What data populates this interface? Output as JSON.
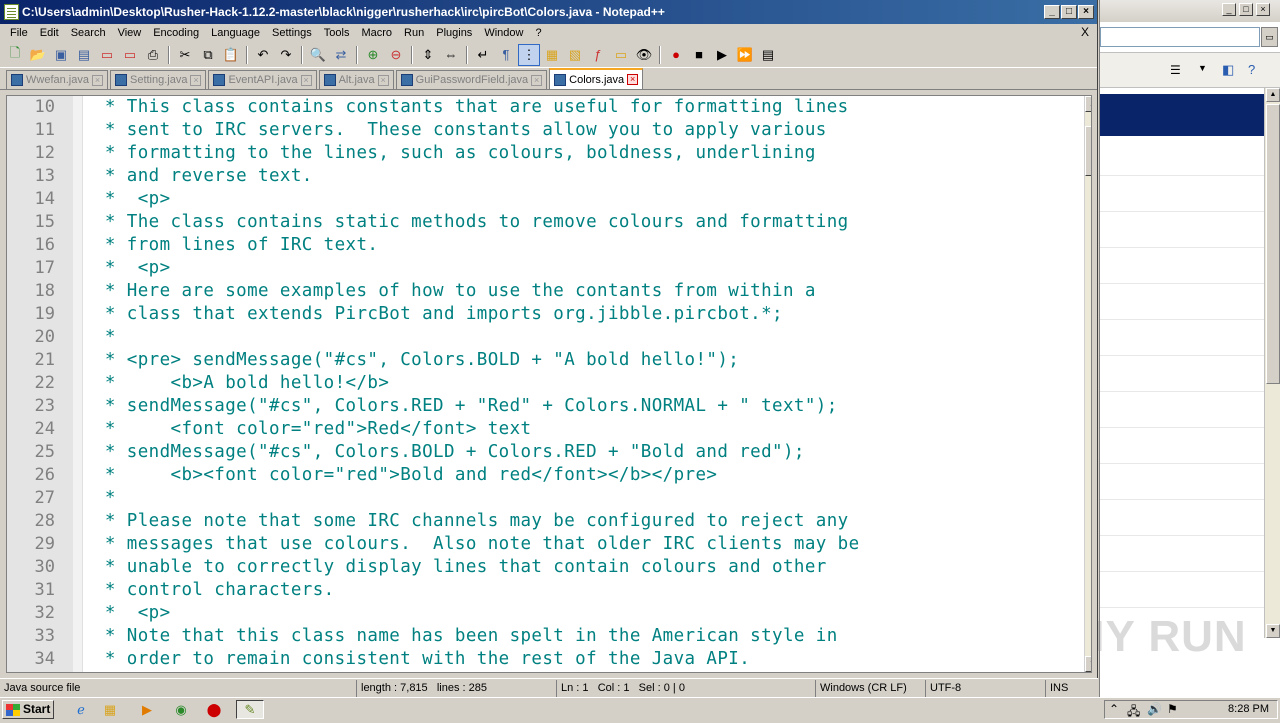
{
  "window": {
    "title": "C:\\Users\\admin\\Desktop\\Rusher-Hack-1.12.2-master\\black\\nigger\\rusherhack\\irc\\pircBot\\Colors.java - Notepad++"
  },
  "menu": [
    "File",
    "Edit",
    "Search",
    "View",
    "Encoding",
    "Language",
    "Settings",
    "Tools",
    "Macro",
    "Run",
    "Plugins",
    "Window",
    "?"
  ],
  "menu_close": "X",
  "tabs": [
    {
      "label": "Wwefan.java"
    },
    {
      "label": "Setting.java"
    },
    {
      "label": "EventAPI.java"
    },
    {
      "label": "Alt.java"
    },
    {
      "label": "GuiPasswordField.java"
    },
    {
      "label": "Colors.java"
    }
  ],
  "lines": [
    {
      "n": "10",
      "t": " * This class contains constants that are useful for formatting lines"
    },
    {
      "n": "11",
      "t": " * sent to IRC servers.  These constants allow you to apply various"
    },
    {
      "n": "12",
      "t": " * formatting to the lines, such as colours, boldness, underlining"
    },
    {
      "n": "13",
      "t": " * and reverse text."
    },
    {
      "n": "14",
      "t": " *  <p>"
    },
    {
      "n": "15",
      "t": " * The class contains static methods to remove colours and formatting"
    },
    {
      "n": "16",
      "t": " * from lines of IRC text."
    },
    {
      "n": "17",
      "t": " *  <p>"
    },
    {
      "n": "18",
      "t": " * Here are some examples of how to use the contants from within a"
    },
    {
      "n": "19",
      "t": " * class that extends PircBot and imports org.jibble.pircbot.*;"
    },
    {
      "n": "20",
      "t": " *"
    },
    {
      "n": "21",
      "t": " * <pre> sendMessage(\"#cs\", Colors.BOLD + \"A bold hello!\");"
    },
    {
      "n": "22",
      "t": " *     <b>A bold hello!</b>"
    },
    {
      "n": "23",
      "t": " * sendMessage(\"#cs\", Colors.RED + \"Red\" + Colors.NORMAL + \" text\");"
    },
    {
      "n": "24",
      "t": " *     <font color=\"red\">Red</font> text"
    },
    {
      "n": "25",
      "t": " * sendMessage(\"#cs\", Colors.BOLD + Colors.RED + \"Bold and red\");"
    },
    {
      "n": "26",
      "t": " *     <b><font color=\"red\">Bold and red</font></b></pre>"
    },
    {
      "n": "27",
      "t": " *"
    },
    {
      "n": "28",
      "t": " * Please note that some IRC channels may be configured to reject any"
    },
    {
      "n": "29",
      "t": " * messages that use colours.  Also note that older IRC clients may be"
    },
    {
      "n": "30",
      "t": " * unable to correctly display lines that contain colours and other"
    },
    {
      "n": "31",
      "t": " * control characters."
    },
    {
      "n": "32",
      "t": " *  <p>"
    },
    {
      "n": "33",
      "t": " * Note that this class name has been spelt in the American style in"
    },
    {
      "n": "34",
      "t": " * order to remain consistent with the rest of the Java API."
    }
  ],
  "status": {
    "filetype": "Java source file",
    "length": "length : 7,815",
    "lines": "lines : 285",
    "ln": "Ln : 1",
    "col": "Col : 1",
    "sel": "Sel : 0 | 0",
    "eol": "Windows (CR LF)",
    "encoding": "UTF-8",
    "mode": "INS"
  },
  "taskbar": {
    "start": "Start",
    "clock": "8:28 PM"
  },
  "watermark": "ANY RUN",
  "colors": {
    "code_text": "#008080",
    "line_numbers": "#808080",
    "active_tab_accent": "#f5a623",
    "title_gradient_start": "#0a246a"
  }
}
